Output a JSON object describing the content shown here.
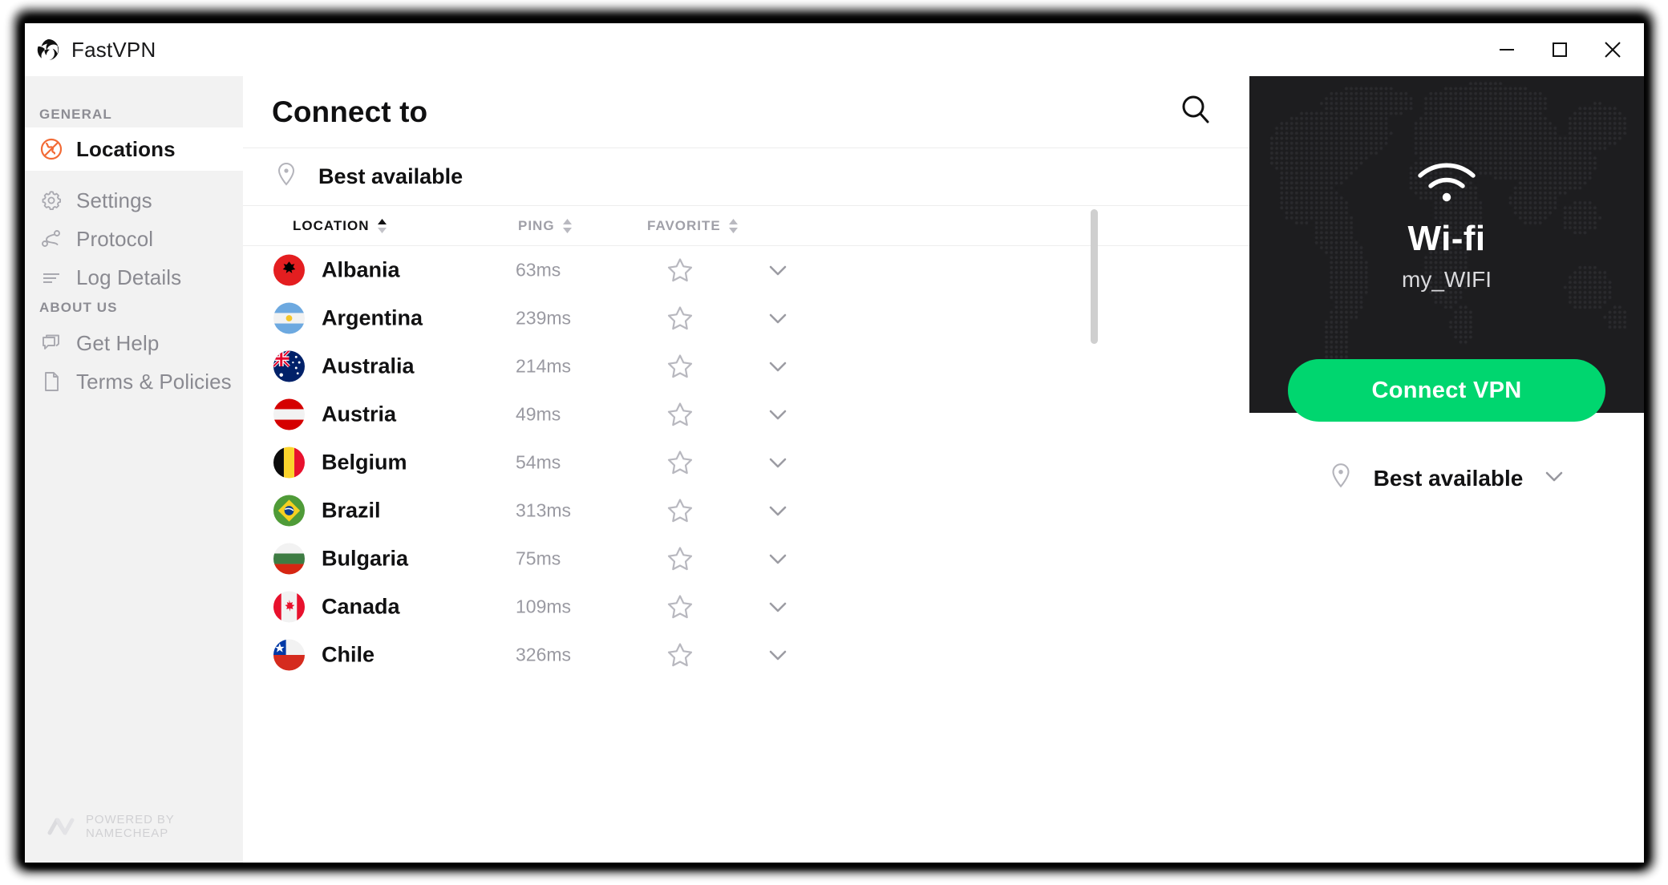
{
  "window": {
    "app_title": "FastVPN",
    "logo_icon": "fastvpn-logo-icon",
    "controls": {
      "minimize": "minimize-icon",
      "maximize": "maximize-icon",
      "close": "close-icon"
    }
  },
  "sidebar": {
    "sections": [
      {
        "title": "GENERAL"
      },
      {
        "title": "ABOUT US"
      }
    ],
    "general_title": "GENERAL",
    "about_title": "ABOUT US",
    "items": [
      {
        "id": "locations",
        "label": "Locations",
        "icon": "globe-icon",
        "active": true
      },
      {
        "id": "settings",
        "label": "Settings",
        "icon": "gear-icon",
        "active": false
      },
      {
        "id": "protocol",
        "label": "Protocol",
        "icon": "protocol-nodes-icon",
        "active": false
      },
      {
        "id": "log-details",
        "label": "Log Details",
        "icon": "list-lines-icon",
        "active": false
      },
      {
        "id": "get-help",
        "label": "Get Help",
        "icon": "chat-bubble-icon",
        "active": false
      },
      {
        "id": "terms-policies",
        "label": "Terms & Policies",
        "icon": "document-icon",
        "active": false
      }
    ],
    "footer": {
      "text": "POWERED BY NAMECHEAP",
      "logo_icon": "namecheap-logo-icon"
    }
  },
  "main": {
    "title": "Connect to",
    "search_icon": "search-icon",
    "best_available": {
      "label": "Best available",
      "icon": "map-pin-icon"
    },
    "columns": [
      {
        "key": "location",
        "label": "LOCATION",
        "sorted": true,
        "direction": "asc"
      },
      {
        "key": "ping",
        "label": "PING",
        "sorted": false,
        "direction": "none"
      },
      {
        "key": "favorite",
        "label": "FAVORITE",
        "sorted": false,
        "direction": "none"
      }
    ],
    "rows": [
      {
        "country": "Albania",
        "flag": "al",
        "ping": "63ms",
        "favorite": false
      },
      {
        "country": "Argentina",
        "flag": "ar",
        "ping": "239ms",
        "favorite": false
      },
      {
        "country": "Australia",
        "flag": "au",
        "ping": "214ms",
        "favorite": false
      },
      {
        "country": "Austria",
        "flag": "at",
        "ping": "49ms",
        "favorite": false
      },
      {
        "country": "Belgium",
        "flag": "be",
        "ping": "54ms",
        "favorite": false
      },
      {
        "country": "Brazil",
        "flag": "br",
        "ping": "313ms",
        "favorite": false
      },
      {
        "country": "Bulgaria",
        "flag": "bg",
        "ping": "75ms",
        "favorite": false
      },
      {
        "country": "Canada",
        "flag": "ca",
        "ping": "109ms",
        "favorite": false
      },
      {
        "country": "Chile",
        "flag": "cl",
        "ping": "326ms",
        "favorite": false
      }
    ]
  },
  "right_panel": {
    "network": {
      "icon": "wifi-icon",
      "type": "Wi-fi",
      "ssid": "my_WIFI"
    },
    "connect_button": {
      "label": "Connect VPN",
      "color": "#00d66f"
    },
    "selected_location": {
      "label": "Best available",
      "icon": "map-pin-icon",
      "chevron": "chevron-down-icon"
    }
  },
  "colors": {
    "accent_orange": "#f26b36",
    "connect_green": "#00d66f",
    "sidebar_bg": "#f2f2f2",
    "map_bg": "#1d1d1f",
    "muted_text": "#9a9aa2"
  }
}
